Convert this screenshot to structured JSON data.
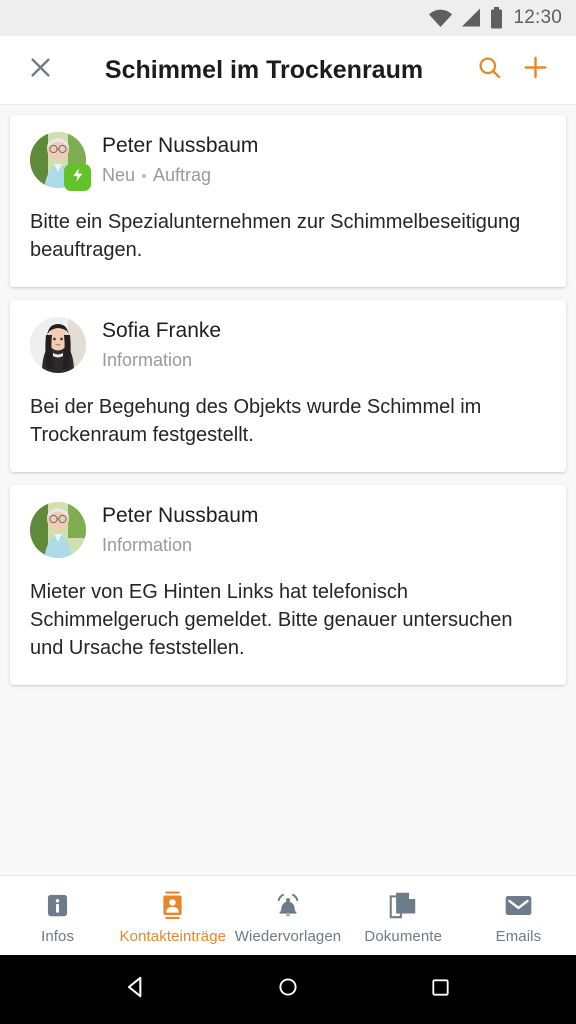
{
  "status_bar": {
    "time": "12:30",
    "icons": [
      "wifi-icon",
      "cellular-signal-icon",
      "battery-icon"
    ]
  },
  "app_bar": {
    "close_icon": "close-icon",
    "title": "Schimmel im Trockenraum",
    "search_icon": "search-icon",
    "add_icon": "plus-icon",
    "accent_color": "#e8872a"
  },
  "entries": [
    {
      "avatar": "avatar-peter-nussbaum",
      "badge_icon": "lightning-bolt-icon",
      "badge_color": "#62c329",
      "name": "Peter Nussbaum",
      "status": "Neu",
      "category": "Auftrag",
      "separator": "·",
      "text": "Bitte ein Spezialunternehmen zur Schimmelbeseitigung beauftragen."
    },
    {
      "avatar": "avatar-sofia-franke",
      "badge_icon": null,
      "name": "Sofia Franke",
      "status": "Information",
      "category": null,
      "text": "Bei der Begehung des Objekts wurde Schimmel im Trockenraum festgestellt."
    },
    {
      "avatar": "avatar-peter-nussbaum",
      "badge_icon": null,
      "name": "Peter Nussbaum",
      "status": "Information",
      "category": null,
      "text": "Mieter von EG Hinten Links hat telefonisch Schimmelgeruch gemeldet. Bitte genauer untersuchen und Ursache feststellen."
    }
  ],
  "tab_bar": {
    "active_index": 1,
    "active_color": "#e8872a",
    "inactive_color": "#6d7c8a",
    "tabs": [
      {
        "label": "Infos",
        "icon": "info-icon"
      },
      {
        "label": "Kontakteinträge",
        "icon": "contact-card-icon"
      },
      {
        "label": "Wiedervorlagen",
        "icon": "bell-icon"
      },
      {
        "label": "Dokumente",
        "icon": "documents-icon"
      },
      {
        "label": "Emails",
        "icon": "envelope-icon"
      }
    ]
  },
  "android_nav": {
    "back": "back-triangle-icon",
    "home": "home-circle-icon",
    "recents": "recents-square-icon"
  }
}
